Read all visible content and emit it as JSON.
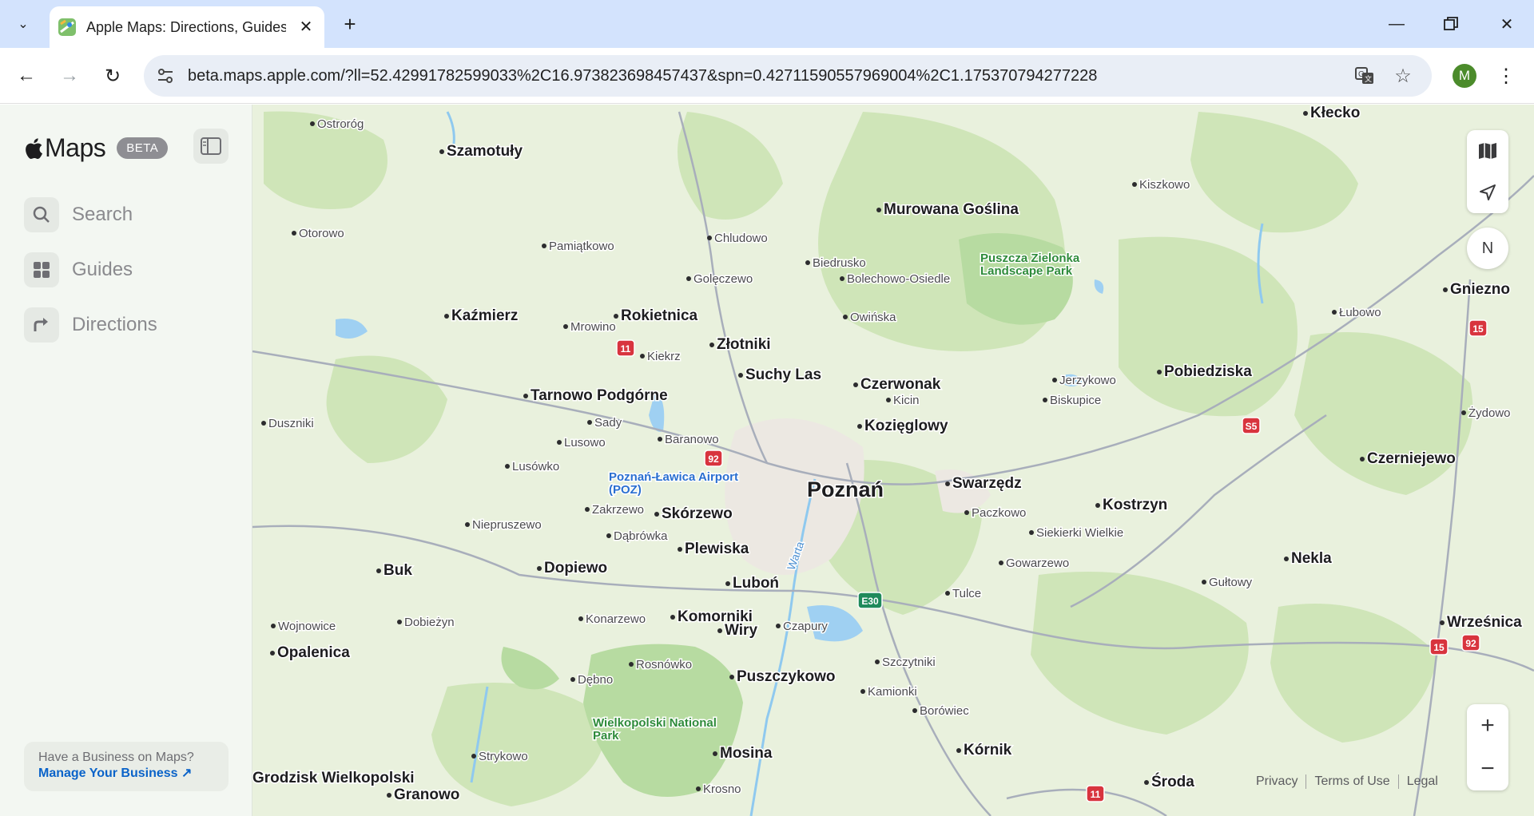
{
  "browser": {
    "tab_title": "Apple Maps: Directions, Guides",
    "url": "beta.maps.apple.com/?ll=52.42991782599033%2C16.973823698457437&spn=0.42711590557969004%2C1.175370794277228",
    "profile_initial": "M"
  },
  "sidebar": {
    "logo_text": "Maps",
    "beta_label": "BETA",
    "items": [
      {
        "label": "Search",
        "icon": "search-icon"
      },
      {
        "label": "Guides",
        "icon": "guides-icon"
      },
      {
        "label": "Directions",
        "icon": "directions-icon"
      }
    ],
    "business": {
      "question": "Have a Business on Maps?",
      "link": "Manage Your Business ↗"
    }
  },
  "map": {
    "compass_label": "N",
    "footer": [
      "Privacy",
      "Terms of Use",
      "Legal"
    ],
    "colors": {
      "land": "#e9f1dd",
      "forest": "#c9e2b0",
      "water": "#8fc9ef",
      "road": "#a8aebb",
      "major_road": "#ffffff"
    },
    "places": [
      {
        "name": "Ostroróg"
      },
      {
        "name": "Szamotuły"
      },
      {
        "name": "Otorowo"
      },
      {
        "name": "Pamiątkowo"
      },
      {
        "name": "Chludowo"
      },
      {
        "name": "Murowana Goślina"
      },
      {
        "name": "Kiszkowo"
      },
      {
        "name": "Kłecko"
      },
      {
        "name": "Biedrusko"
      },
      {
        "name": "Bolechowo-Osiedle"
      },
      {
        "name": "Golęczewo"
      },
      {
        "name": "Puszcza Zielonka Landscape Park"
      },
      {
        "name": "Gniezno"
      },
      {
        "name": "Kaźmierz"
      },
      {
        "name": "Mrowino"
      },
      {
        "name": "Rokietnica"
      },
      {
        "name": "Owińska"
      },
      {
        "name": "Łubowo"
      },
      {
        "name": "Złotniki"
      },
      {
        "name": "Kiekrz"
      },
      {
        "name": "Suchy Las"
      },
      {
        "name": "Czerwonak"
      },
      {
        "name": "Kicin"
      },
      {
        "name": "Jerzykowo"
      },
      {
        "name": "Pobiedziska"
      },
      {
        "name": "Biskupice"
      },
      {
        "name": "Tarnowo Podgórne"
      },
      {
        "name": "Duszniki"
      },
      {
        "name": "Sady"
      },
      {
        "name": "Kozięglowy"
      },
      {
        "name": "Żydowo"
      },
      {
        "name": "Lusowo"
      },
      {
        "name": "Baranowo"
      },
      {
        "name": "Czerniejewo"
      },
      {
        "name": "Lusówko"
      },
      {
        "name": "Poznań-Ławica Airport (POZ)"
      },
      {
        "name": "Poznań"
      },
      {
        "name": "Swarzędz"
      },
      {
        "name": "Zakrzewo"
      },
      {
        "name": "Skórzewo"
      },
      {
        "name": "Paczkowo"
      },
      {
        "name": "Kostrzyn"
      },
      {
        "name": "Niepruszewo"
      },
      {
        "name": "Dąbrówka"
      },
      {
        "name": "Siekierki Wielkie"
      },
      {
        "name": "Plewiska"
      },
      {
        "name": "Buk"
      },
      {
        "name": "Dopiewo"
      },
      {
        "name": "Gowarzewo"
      },
      {
        "name": "Nekla"
      },
      {
        "name": "Luboń"
      },
      {
        "name": "Gułtowy"
      },
      {
        "name": "Tulce"
      },
      {
        "name": "Warta"
      },
      {
        "name": "Wojnowice"
      },
      {
        "name": "Dobieżyn"
      },
      {
        "name": "Konarzewo"
      },
      {
        "name": "Komorniki"
      },
      {
        "name": "Czapury"
      },
      {
        "name": "Wiry"
      },
      {
        "name": "Wrześnica"
      },
      {
        "name": "Opalenica"
      },
      {
        "name": "Rosnówko"
      },
      {
        "name": "Szczytniki"
      },
      {
        "name": "Dębno"
      },
      {
        "name": "Puszczykowo"
      },
      {
        "name": "Kamionki"
      },
      {
        "name": "Borówiec"
      },
      {
        "name": "Wielkopolski National Park"
      },
      {
        "name": "Strykowo"
      },
      {
        "name": "Mosina"
      },
      {
        "name": "Kórnik"
      },
      {
        "name": "Grodzisk Wielkopolski"
      },
      {
        "name": "Granowo"
      },
      {
        "name": "Krosno"
      },
      {
        "name": "Środa"
      }
    ],
    "road_shields": [
      "11",
      "92",
      "15",
      "S5",
      "E30",
      "15",
      "92",
      "11"
    ]
  }
}
